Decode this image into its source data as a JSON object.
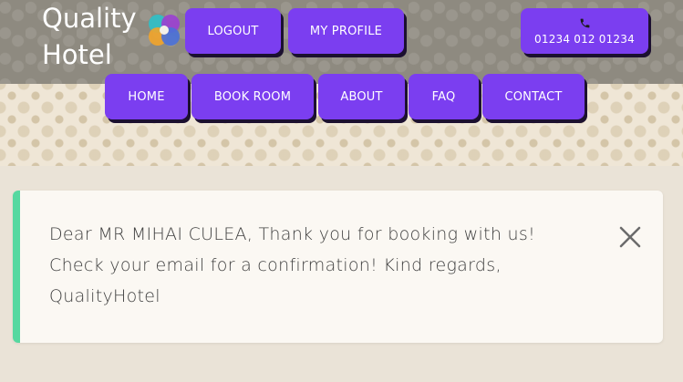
{
  "logo": {
    "line1": "Quality",
    "line2": "Hotel",
    "icon": "hotel-logo-icon"
  },
  "top_nav": {
    "logout_label": "LOGOUT",
    "profile_label": "MY PROFILE",
    "phone_icon": "phone-icon",
    "phone_number": "01234 012 01234"
  },
  "main_nav": {
    "items": [
      {
        "label": "HOME"
      },
      {
        "label": "BOOK ROOM"
      },
      {
        "label": "ABOUT"
      },
      {
        "label": "FAQ"
      },
      {
        "label": "CONTACT"
      }
    ]
  },
  "alert": {
    "message": "Dear MR MIHAI CULEA, Thank you for booking with us! Check your email for a confirmation! Kind regards, QualityHotel",
    "close_icon": "close-icon"
  },
  "colors": {
    "accent": "#7b3ef0",
    "success_border": "#56d8a0",
    "header_bg": "#8e8a80"
  }
}
